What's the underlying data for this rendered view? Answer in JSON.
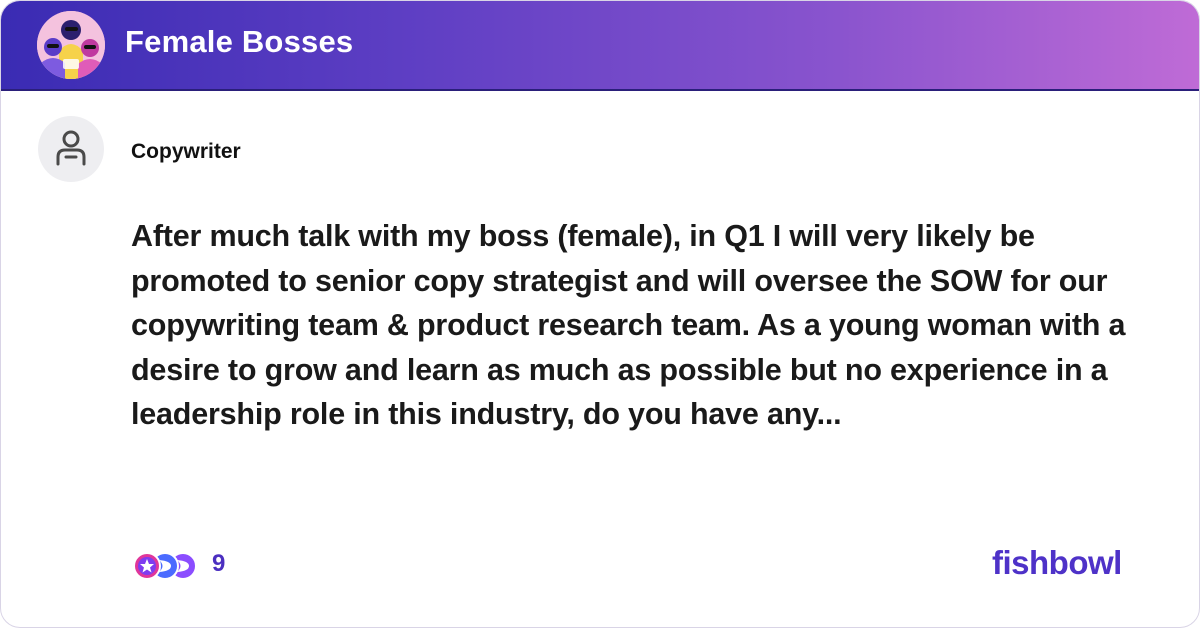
{
  "header": {
    "group_title": "Female Bosses",
    "avatar_icon": "group-illustration-icon",
    "gradient_colors": [
      "#3a2bb3",
      "#8a54ce",
      "#bf6bd6"
    ]
  },
  "post": {
    "author_role": "Copywriter",
    "author_icon": "anonymous-user-icon",
    "body": "After much talk with my boss (female), in Q1 I will very likely be promoted to senior copy strategist and will oversee the SOW for our copywriting team & product research team. As a young woman with a desire to grow and learn as much as possible but no experience in a leadership role in this industry, do you have any..."
  },
  "footer": {
    "reaction_icons": [
      "heart-reaction-icon",
      "star-reaction-icon",
      "clap-reaction-icon"
    ],
    "reaction_count": "9",
    "brand": "fishbowl",
    "brand_color": "#4e32c8"
  }
}
